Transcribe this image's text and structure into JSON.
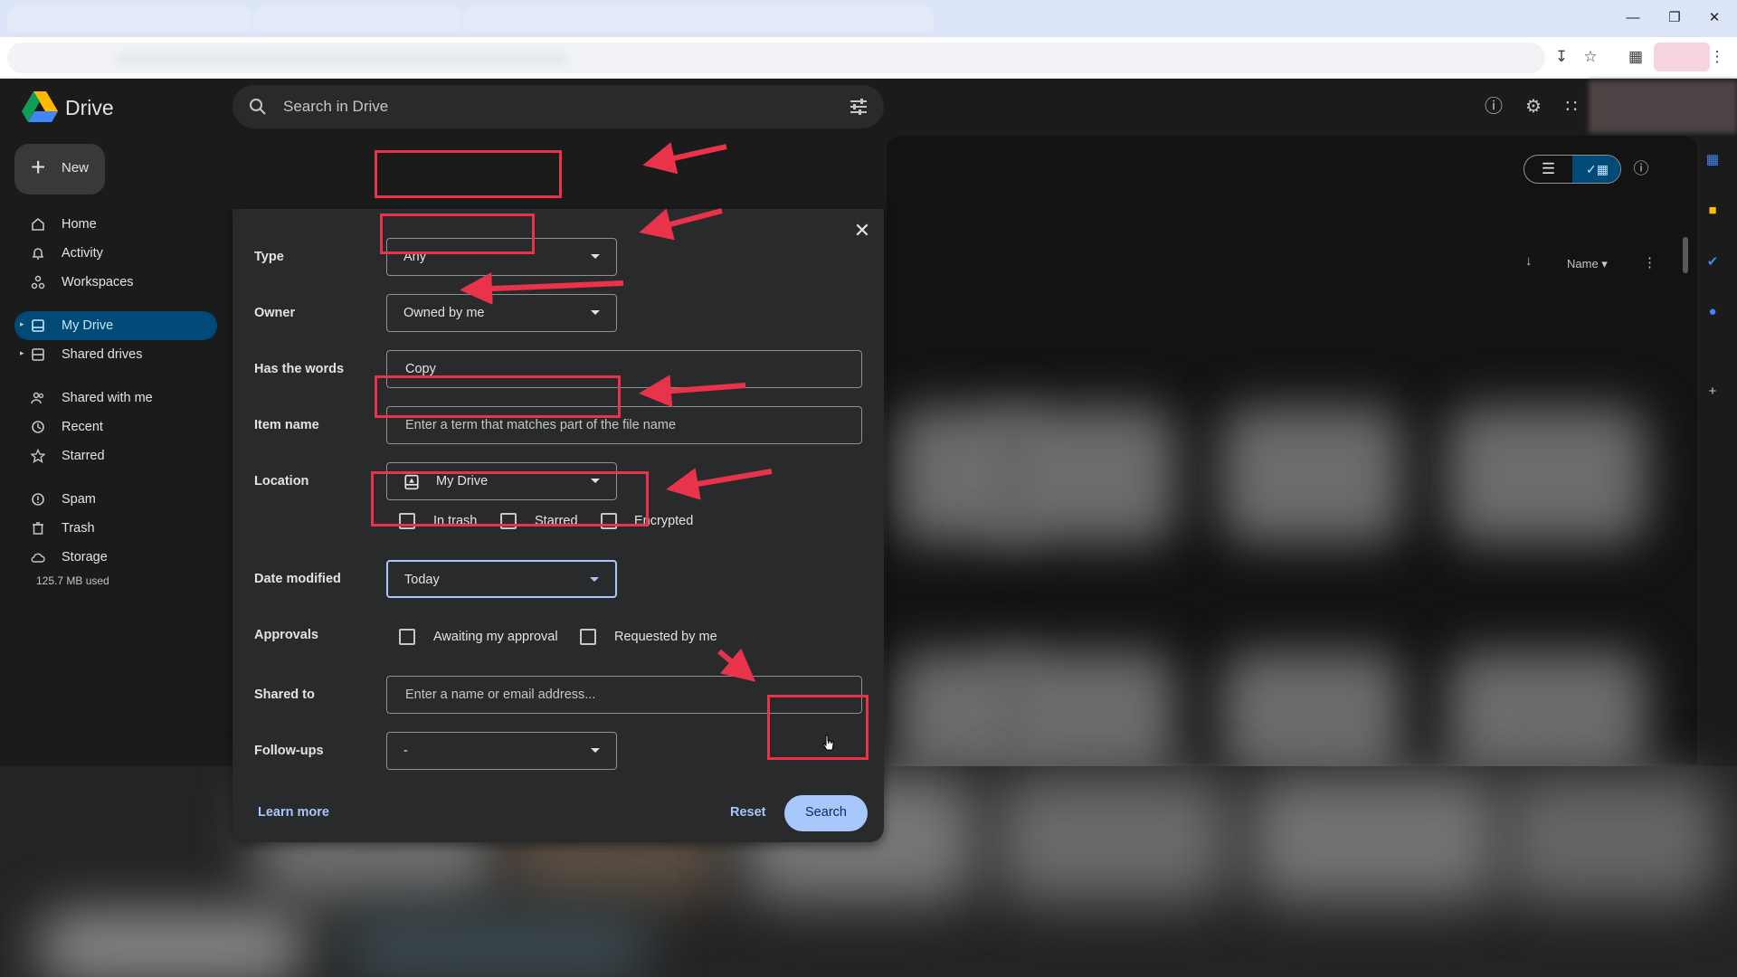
{
  "app": {
    "name": "Drive"
  },
  "search": {
    "placeholder": "Search in Drive"
  },
  "sidebar": {
    "new_label": "New",
    "items": [
      {
        "label": "Home",
        "icon": "home-icon"
      },
      {
        "label": "Activity",
        "icon": "bell-icon"
      },
      {
        "label": "Workspaces",
        "icon": "workspaces-icon"
      },
      {
        "label": "My Drive",
        "icon": "my-drive-icon",
        "active": true
      },
      {
        "label": "Shared drives",
        "icon": "shared-drives-icon"
      },
      {
        "label": "Shared with me",
        "icon": "people-icon"
      },
      {
        "label": "Recent",
        "icon": "clock-icon"
      },
      {
        "label": "Starred",
        "icon": "star-icon"
      },
      {
        "label": "Spam",
        "icon": "spam-icon"
      },
      {
        "label": "Trash",
        "icon": "trash-icon"
      },
      {
        "label": "Storage",
        "icon": "cloud-icon"
      }
    ],
    "storage_used": "125.7 MB used"
  },
  "toolbar": {
    "sort_label": "Name"
  },
  "dialog": {
    "type": {
      "label": "Type",
      "value": "Any"
    },
    "owner": {
      "label": "Owner",
      "value": "Owned by me"
    },
    "has_words": {
      "label": "Has the words",
      "value": "Copy"
    },
    "item_name": {
      "label": "Item name",
      "placeholder": "Enter a term that matches part of the file name"
    },
    "location": {
      "label": "Location",
      "value": "My Drive"
    },
    "checks": {
      "in_trash": "In trash",
      "starred": "Starred",
      "encrypted": "Encrypted"
    },
    "date_modified": {
      "label": "Date modified",
      "value": "Today"
    },
    "approvals": {
      "label": "Approvals",
      "awaiting": "Awaiting my approval",
      "requested": "Requested by me"
    },
    "shared_to": {
      "label": "Shared to",
      "placeholder": "Enter a name or email address..."
    },
    "follow_ups": {
      "label": "Follow-ups",
      "value": "-"
    },
    "learn_more": "Learn more",
    "reset": "Reset",
    "search": "Search"
  },
  "colors": {
    "annotation": "#e8334a",
    "accent": "#a8c7fa",
    "active_nav": "#004a77"
  }
}
